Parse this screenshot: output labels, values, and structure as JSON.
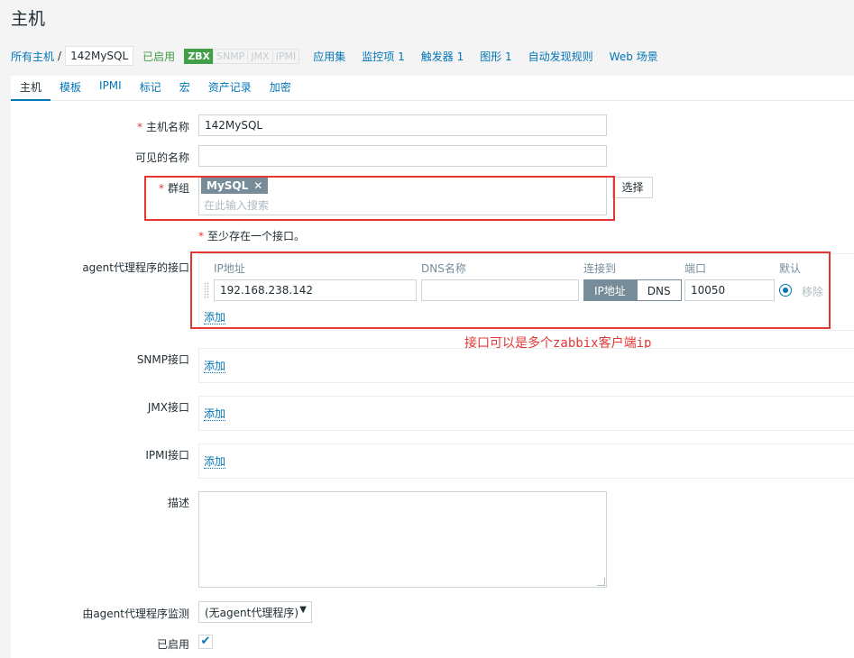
{
  "page": {
    "title": "主机"
  },
  "nav": {
    "all_hosts": "所有主机",
    "separator": "/",
    "current_host": "142MySQL",
    "status": "已启用",
    "availability": [
      "ZBX",
      "SNMP",
      "JMX",
      "IPMI"
    ],
    "links": [
      "应用集",
      "监控项 1",
      "触发器 1",
      "图形 1",
      "自动发现规则",
      "Web 场景"
    ]
  },
  "tabs": [
    "主机",
    "模板",
    "IPMI",
    "标记",
    "宏",
    "资产记录",
    "加密"
  ],
  "form": {
    "required_mark": "*",
    "host_name_label": "主机名称",
    "host_name_value": "142MySQL",
    "visible_name_label": "可见的名称",
    "visible_name_value": "",
    "groups_label": "群组",
    "group_chip": "MySQL",
    "group_chip_remove": "✕",
    "groups_placeholder": "在此输入搜索",
    "select_button": "选择",
    "interface_note": "至少存在一个接口。",
    "agent_label": "agent代理程序的接口",
    "iface_headers": {
      "ip": "IP地址",
      "dns": "DNS名称",
      "connect": "连接到",
      "port": "端口",
      "default": "默认"
    },
    "iface_ip_value": "192.168.238.142",
    "iface_dns_value": "",
    "connect_ip": "IP地址",
    "connect_dns": "DNS",
    "iface_port_value": "10050",
    "remove_label": "移除",
    "add_label": "添加",
    "snmp_label": "SNMP接口",
    "jmx_label": "JMX接口",
    "ipmi_label": "IPMI接口",
    "description_label": "描述",
    "proxy_label": "由agent代理程序监测",
    "proxy_value": "(无agent代理程序)",
    "proxy_arrow": "▼",
    "enabled_label": "已启用",
    "enabled_check": "✔"
  },
  "annotation": "接口可以是多个zabbix客户端ip",
  "colors": {
    "accent": "#0275b8",
    "success": "#429e47",
    "annotation": "#e33734"
  }
}
